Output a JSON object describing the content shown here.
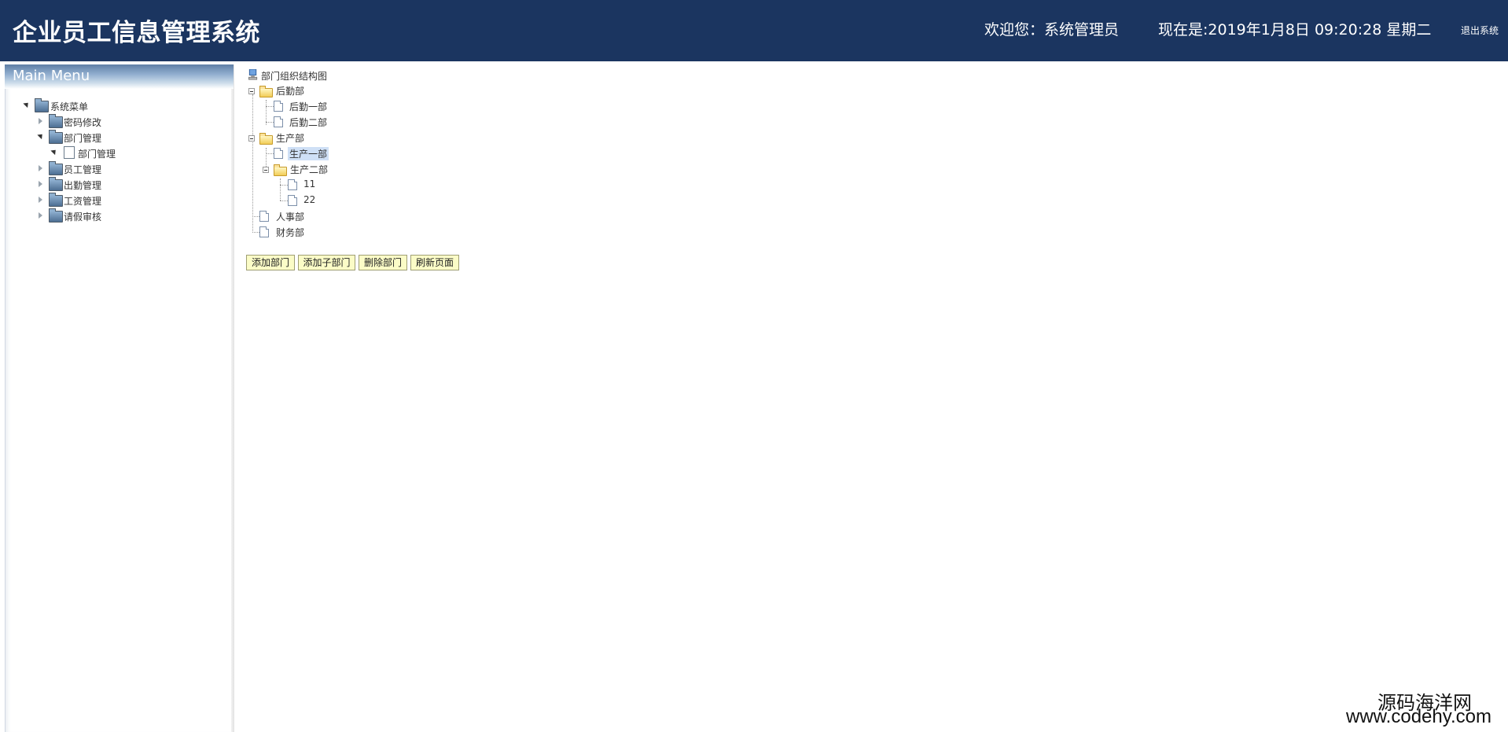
{
  "header": {
    "title": "企业员工信息管理系统",
    "welcome": "欢迎您：系统管理员",
    "clock": "现在是:2019年1月8日 09:20:28 星期二",
    "logout": "退出系统",
    "bg_color": "#1b3560"
  },
  "sidebar": {
    "header": "Main Menu",
    "root": "系统菜单",
    "items": [
      {
        "label": "密码修改",
        "expanded": false
      },
      {
        "label": "部门管理",
        "expanded": true,
        "children": [
          {
            "label": "部门管理"
          }
        ]
      },
      {
        "label": "员工管理",
        "expanded": false
      },
      {
        "label": "出勤管理",
        "expanded": false
      },
      {
        "label": "工资管理",
        "expanded": false
      },
      {
        "label": "请假审核",
        "expanded": false
      }
    ]
  },
  "tree": {
    "root": "部门组织结构图",
    "nodes": [
      {
        "label": "后勤部",
        "type": "folder",
        "expanded": true,
        "children": [
          "后勤一部",
          "后勤二部"
        ]
      },
      {
        "label": "生产部",
        "type": "folder",
        "expanded": true,
        "children": [
          {
            "label": "生产一部",
            "selected": true
          },
          {
            "label": "生产二部",
            "type": "folder",
            "expanded": true,
            "children": [
              "11",
              "22"
            ]
          }
        ]
      },
      {
        "label": "人事部",
        "type": "doc"
      },
      {
        "label": "财务部",
        "type": "doc"
      }
    ],
    "selected": "生产一部"
  },
  "buttons": {
    "add_dept": "添加部门",
    "add_sub": "添加子部门",
    "delete": "删除部门",
    "refresh": "刷新页面"
  },
  "watermark": {
    "line1": "源码海洋网",
    "line2": "www.codehy.com"
  }
}
